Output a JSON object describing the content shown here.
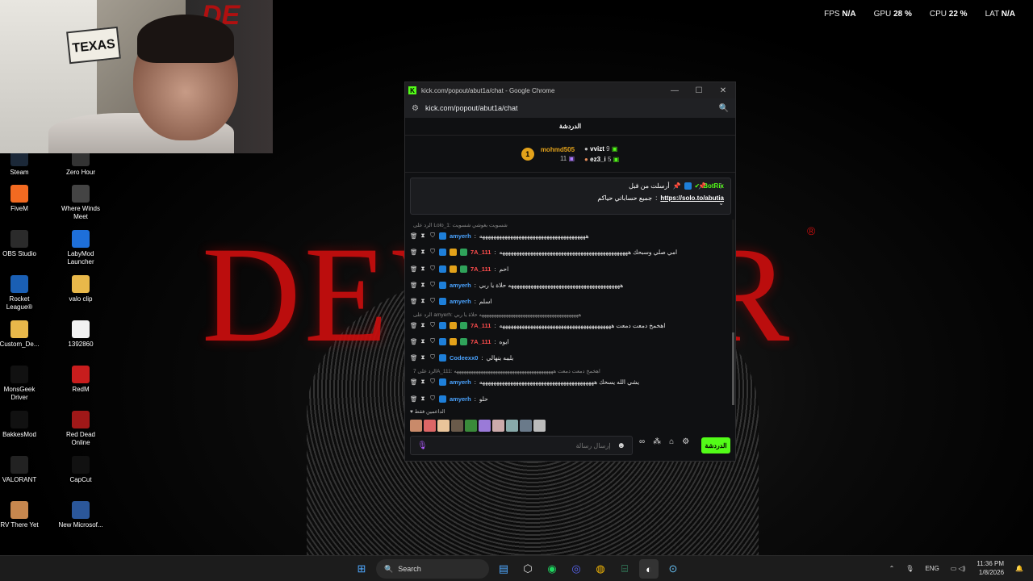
{
  "overlay": {
    "fps_label": "FPS",
    "fps_value": "N/A",
    "gpu_label": "GPU",
    "gpu_value": "28 %",
    "cpu_label": "CPU",
    "cpu_value": "22 %",
    "lat_label": "LAT",
    "lat_value": "N/A"
  },
  "webcam": {
    "flag_text": "TEXAS"
  },
  "wallpaper": {
    "title": "DEVOUR",
    "reg_mark": "®"
  },
  "desktop_icons": [
    {
      "label": "Steam",
      "icon": "steam-icon",
      "color": "#1b2838"
    },
    {
      "label": "Zero Hour",
      "icon": "zero-hour-icon",
      "color": "#333333"
    },
    {
      "label": "FiveM",
      "icon": "fivem-icon",
      "color": "#f26a21"
    },
    {
      "label": "Where Winds Meet",
      "icon": "where-winds-meet-icon",
      "color": "#444444"
    },
    {
      "label": "OBS Studio",
      "icon": "obs-icon",
      "color": "#2b2b2b"
    },
    {
      "label": "LabyMod Launcher",
      "icon": "labymod-icon",
      "color": "#1e6fd9"
    },
    {
      "label": "Rocket League®",
      "icon": "rocket-league-icon",
      "color": "#1a5fb4"
    },
    {
      "label": "valo clip",
      "icon": "folder-icon",
      "color": "#e8b84a"
    },
    {
      "label": "Custom_De...",
      "icon": "folder-icon",
      "color": "#e8b84a"
    },
    {
      "label": "1392860",
      "icon": "file-icon",
      "color": "#f2f2f2"
    },
    {
      "label": "MonsGeek Driver",
      "icon": "monsgeek-icon",
      "color": "#111111"
    },
    {
      "label": "RedM",
      "icon": "redm-icon",
      "color": "#c81d1d"
    },
    {
      "label": "BakkesMod",
      "icon": "bakkesmod-icon",
      "color": "#111111"
    },
    {
      "label": "Red Dead Online",
      "icon": "red-dead-online-icon",
      "color": "#a01818"
    },
    {
      "label": "VALORANT",
      "icon": "valorant-icon",
      "color": "#222222"
    },
    {
      "label": "CapCut",
      "icon": "capcut-icon",
      "color": "#111111"
    },
    {
      "label": "RV There Yet",
      "icon": "rv-there-yet-icon",
      "color": "#c7874e"
    },
    {
      "label": "New Microsof...",
      "icon": "word-icon",
      "color": "#2b579a"
    }
  ],
  "browser": {
    "window_title": "kick.com/popout/abut1a/chat - Google Chrome",
    "url": "kick.com/popout/abut1a/chat",
    "controls": [
      "—",
      "☐",
      "✕"
    ]
  },
  "chat": {
    "header": "الدردشة",
    "gifters": [
      {
        "rank": "1",
        "name": "mohmd505",
        "count": "11",
        "color": "#e3a21a"
      },
      {
        "name": "vvizt",
        "count": "9",
        "color": "#ffffff"
      },
      {
        "name": "ez3_i",
        "count": "5",
        "color": "#ffffff"
      }
    ],
    "pinned": {
      "pinned_by": "أرسلت من قبل",
      "user": "BotRix",
      "message": "جميع حساباتي حياكم",
      "link": "https://solo.to/abutia"
    },
    "messages": [
      {
        "type": "reply",
        "text": "الرد على Lolo_1: شسويت بغوشي شسويت"
      },
      {
        "type": "msg",
        "user": "amyerh",
        "user_color": "#4aa3ff",
        "text": "ههههههههههههههههههههههههههههههههههههههه"
      },
      {
        "type": "msg",
        "user": "7A_111",
        "user_color": "#ff4d4d",
        "text": "امي صلي وسبحك ههههههههههههههههههههههههههههههههههههههههههههههه"
      },
      {
        "type": "msg",
        "user": "7A_111",
        "user_color": "#ff4d4d",
        "text": "احم"
      },
      {
        "type": "msg",
        "user": "amyerh",
        "user_color": "#4aa3ff",
        "text": "ههههههههههههههههههههههههههههههههههههههههه حلاة يا ربي"
      },
      {
        "type": "msg",
        "user": "amyerh",
        "user_color": "#4aa3ff",
        "text": "اسلم"
      },
      {
        "type": "reply",
        "text": "الرد على amyerh: هههههههههههههههههههههههههههههههههههههههههه حلاة يا ربي"
      },
      {
        "type": "msg",
        "user": "7A_111",
        "user_color": "#ff4d4d",
        "text": "اهخمخ دمعت دمعت ههههههههههههههههههههههههههههههههههههههههه"
      },
      {
        "type": "msg",
        "user": "7A_111",
        "user_color": "#ff4d4d",
        "text": "ايوه"
      },
      {
        "type": "msg",
        "user": "Codeexx0",
        "user_color": "#4aa3ff",
        "text": "يليبه يتهالي"
      },
      {
        "type": "reply",
        "text": "الرد على 7A_111: اهخمخ دمعت دمعت هههههههههههههههههههههههههههههههههههههههههه"
      },
      {
        "type": "msg",
        "user": "amyerh",
        "user_color": "#4aa3ff",
        "text": "يشي الله يسحك هههههههههههههههههههههههههههههههههههههههههه"
      },
      {
        "type": "msg",
        "user": "amyerh",
        "user_color": "#4aa3ff",
        "text": "حلو"
      }
    ],
    "supporters_label": "الداعمين فقط",
    "input_placeholder": "إرسال رسالة",
    "send_label": "الدردشة"
  },
  "taskbar": {
    "search_label": "Search",
    "lang": "ENG",
    "time": "11:36 PM",
    "date": "1/8/2026"
  }
}
